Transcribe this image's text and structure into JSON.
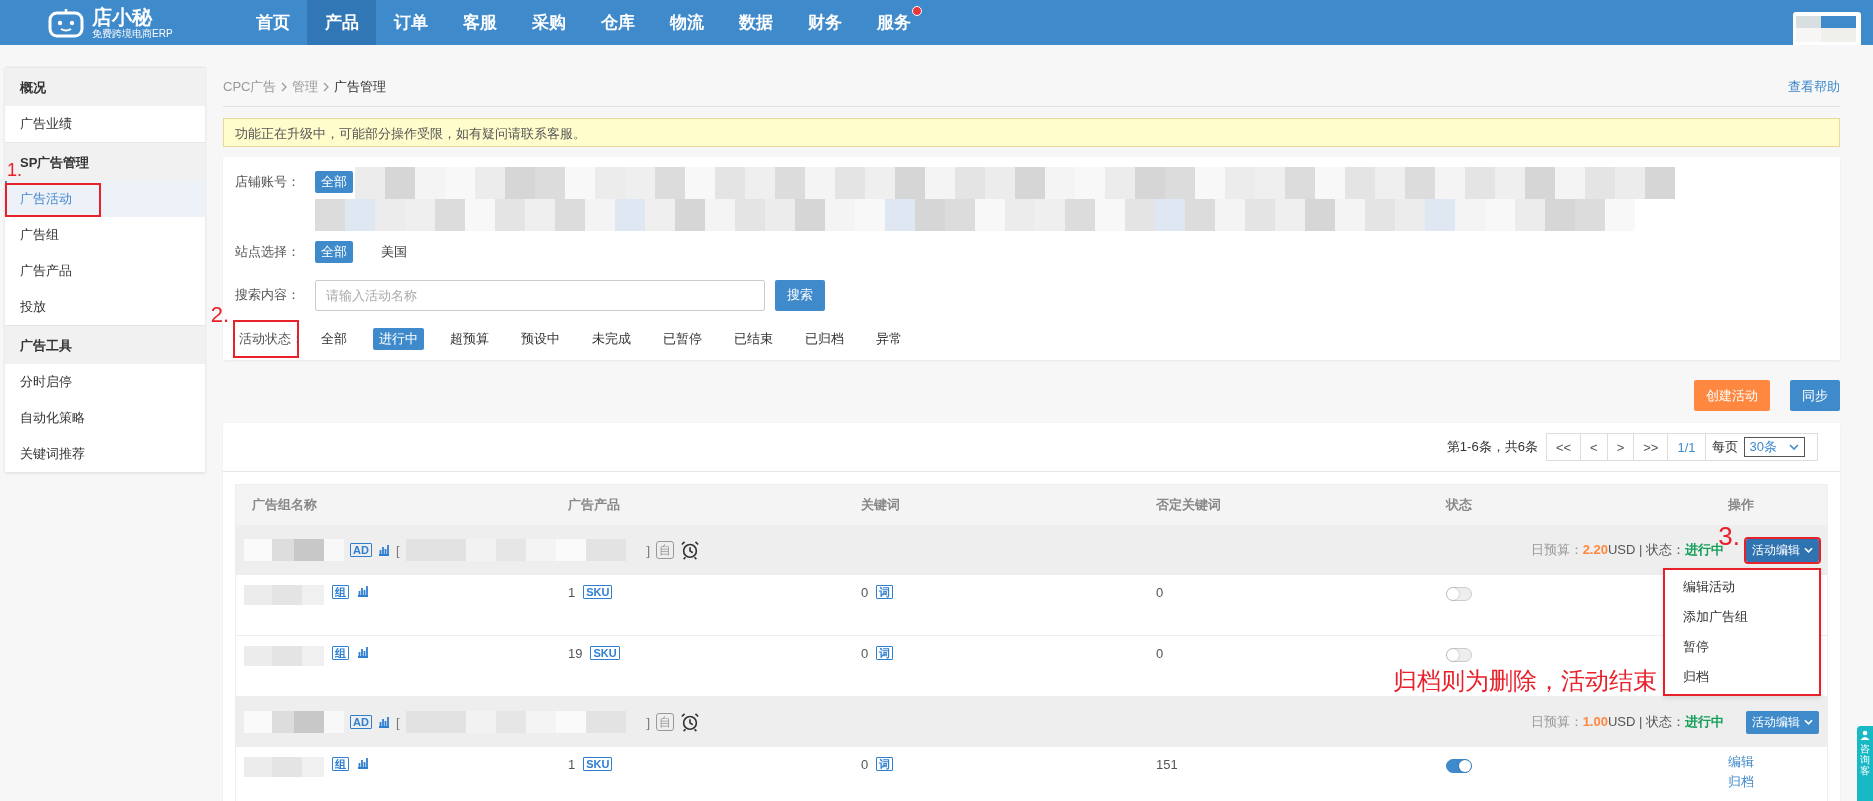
{
  "nav": {
    "logo": {
      "title": "店小秘",
      "subtitle": "免费跨境电商ERP"
    },
    "items": [
      {
        "label": "首页",
        "selected": false,
        "dot": false
      },
      {
        "label": "产品",
        "selected": true,
        "dot": false
      },
      {
        "label": "订单",
        "selected": false,
        "dot": false
      },
      {
        "label": "客服",
        "selected": false,
        "dot": false
      },
      {
        "label": "采购",
        "selected": false,
        "dot": false
      },
      {
        "label": "仓库",
        "selected": false,
        "dot": false
      },
      {
        "label": "物流",
        "selected": false,
        "dot": false
      },
      {
        "label": "数据",
        "selected": false,
        "dot": false
      },
      {
        "label": "财务",
        "selected": false,
        "dot": false
      },
      {
        "label": "服务",
        "selected": false,
        "dot": true
      }
    ]
  },
  "sidebar": [
    {
      "title": "概况",
      "items": [
        {
          "label": "广告业绩",
          "selected": false
        }
      ]
    },
    {
      "title": "SP广告管理",
      "items": [
        {
          "label": "广告活动",
          "selected": true,
          "annotation": "1."
        },
        {
          "label": "广告组",
          "selected": false
        },
        {
          "label": "广告产品",
          "selected": false
        },
        {
          "label": "投放",
          "selected": false
        }
      ]
    },
    {
      "title": "广告工具",
      "items": [
        {
          "label": "分时启停",
          "selected": false
        },
        {
          "label": "自动化策略",
          "selected": false
        },
        {
          "label": "关键词推荐",
          "selected": false
        }
      ]
    }
  ],
  "breadcrumb": [
    {
      "label": "CPC广告",
      "current": false
    },
    {
      "label": "管理",
      "current": false
    },
    {
      "label": "广告管理",
      "current": true
    }
  ],
  "help_link": "查看帮助",
  "notice": "功能正在升级中，可能部分操作受限，如有疑问请联系客服。",
  "filters": {
    "store": {
      "label": "店铺账号：",
      "options": [
        {
          "label": "全部",
          "selected": true
        }
      ]
    },
    "site": {
      "label": "站点选择：",
      "options": [
        {
          "label": "全部",
          "selected": true
        },
        {
          "label": "美国",
          "selected": false
        }
      ]
    },
    "search": {
      "label": "搜索内容：",
      "placeholder": "请输入活动名称",
      "button": "搜索"
    },
    "status": {
      "label": "活动状态：",
      "annotation": "2.",
      "options": [
        {
          "label": "全部",
          "selected": false
        },
        {
          "label": "进行中",
          "selected": true
        },
        {
          "label": "超预算",
          "selected": false
        },
        {
          "label": "预设中",
          "selected": false
        },
        {
          "label": "未完成",
          "selected": false
        },
        {
          "label": "已暂停",
          "selected": false
        },
        {
          "label": "已结束",
          "selected": false
        },
        {
          "label": "已归档",
          "selected": false
        },
        {
          "label": "异常",
          "selected": false
        }
      ]
    }
  },
  "actions": [
    {
      "label": "创建活动",
      "kind": "warning"
    },
    {
      "label": "同步",
      "kind": "primary"
    }
  ],
  "pagination": {
    "summary": "第1-6条，共6条",
    "buttons": [
      "<<",
      "<",
      ">",
      ">>"
    ],
    "page": "1/1",
    "per_page_label": "每页",
    "per_page": "30条"
  },
  "table": {
    "columns": [
      "广告组名称",
      "广告产品",
      "关键词",
      "否定关键词",
      "状态",
      "操作"
    ],
    "campaigns": [
      {
        "ad_tag": "AD",
        "bracket_open": "[",
        "bracket_close": "]",
        "auto_tag": "自",
        "budget_label": "日预算：",
        "budget": "2.20",
        "budget_unit": "USD | 状态：",
        "status": "进行中",
        "action": "活动编辑",
        "annotation": "3.",
        "menu_open": true,
        "menu": [
          "编辑活动",
          "添加广告组",
          "暂停",
          "归档"
        ],
        "note": "归档则为删除，活动结束",
        "groups": [
          {
            "group_tag": "组",
            "products": "1",
            "product_tag": "SKU",
            "keywords": "0",
            "keyword_tag": "词",
            "negative_keywords": "0",
            "on": false
          },
          {
            "group_tag": "组",
            "products": "19",
            "product_tag": "SKU",
            "keywords": "0",
            "keyword_tag": "词",
            "negative_keywords": "0",
            "on": false
          }
        ]
      },
      {
        "ad_tag": "AD",
        "bracket_open": "[",
        "bracket_close": "]",
        "auto_tag": "自",
        "budget_label": "日预算：",
        "budget": "1.00",
        "budget_unit": "USD | 状态：",
        "status": "进行中",
        "action": "活动编辑",
        "menu_open": false,
        "groups": [
          {
            "group_tag": "组",
            "products": "1",
            "product_tag": "SKU",
            "keywords": "0",
            "keyword_tag": "词",
            "negative_keywords": "151",
            "on": true,
            "links": [
              "编辑",
              "归档"
            ]
          }
        ]
      }
    ]
  },
  "support_tab": "咨询客"
}
